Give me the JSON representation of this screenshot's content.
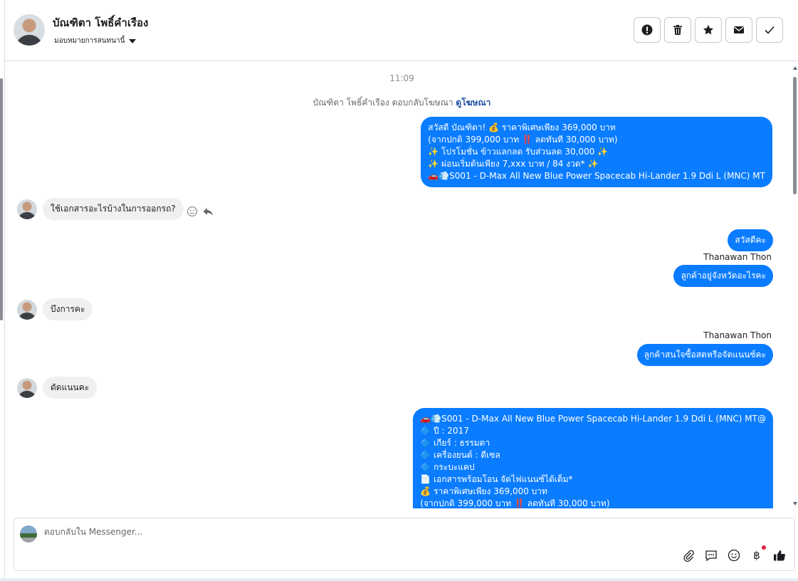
{
  "header": {
    "contact_name": "บัณฑิตา โพธิ์คำเรือง",
    "assign_label": "มอบหมายการสนทนานี้",
    "actions": [
      "spam-icon",
      "trash-icon",
      "star-icon",
      "mail-icon",
      "check-icon"
    ]
  },
  "thread": {
    "time": "11:09",
    "ad_note": "บัณฑิตา โพธิ์คำเรือง ตอบกลับโฆษณา",
    "ad_link": "ดูโฆษณา",
    "msg1": [
      "สวัสดี บัณฑิตา! 💰 ราคาพิเศษเพียง 369,000 บาท",
      "(จากปกติ 399,000 บาท ‼️ ลดทันที 30,000 บาท)",
      "✨ โปรโมชั่น ข้าวแลกลด รับส่วนลด 30,000 ✨",
      "✨ ผ่อนเริ่มต้นเพียง 7,xxx บาท / 84 งวด* ✨",
      "🚗💨S001 - D-Max All New Blue Power Spacecab Hi-Lander 1.9 Ddi L (MNC) MT"
    ],
    "msg2": "ใช้เอกสารอะไรบ้างในการออกรถ?",
    "msg3": "สวัสดีคะ",
    "sender1": "Thanawan Thon",
    "msg4": "ลูกค้าอยู่จังหวัดอะไรคะ",
    "msg5": "บึงการคะ",
    "sender2": "Thanawan Thon",
    "msg6": "ลูกค้าสนใจซื้อสดหรือจัดแนนซ์คะ",
    "msg7": "ดัดแนนคะ",
    "msg8": [
      "🚗💨S001 - D-Max All New Blue Power Spacecab Hi-Lander 1.9 Ddi L (MNC) MT@",
      "🔷 ปี : 2017",
      "🔷 เกียร์ : ธรรมดา",
      "🔷 เครื่องยนต์ : ดีเซล",
      "🔷 กระบะแคป",
      "📄 เอกสารพร้อมโอน จัดไฟแนนซ์ได้เต็ม*",
      "💰 ราคาพิเศษเพียง 369,000 บาท",
      "(จากปกติ 399,000 บาท ‼️ ลดทันที 30,000 บาท)"
    ]
  },
  "composer": {
    "placeholder": "ตอบกลับใน Messenger...",
    "tools": [
      "attach-icon",
      "saved-reply-icon",
      "emoji-icon",
      "baht-icon",
      "like-icon"
    ],
    "baht_symbol": "฿"
  },
  "colors": {
    "accent": "#0a7cff",
    "incoming": "#f0f0f0"
  }
}
